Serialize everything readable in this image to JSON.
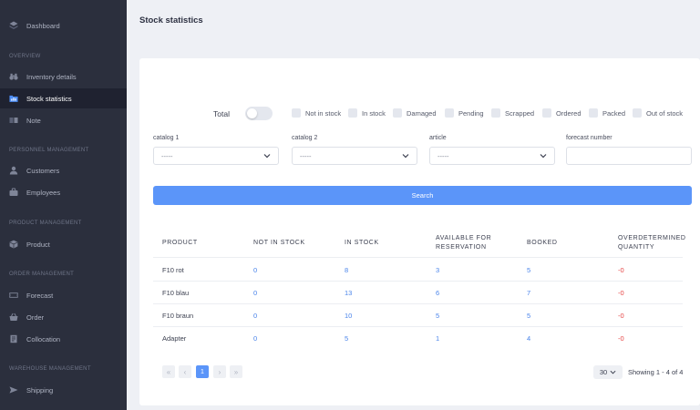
{
  "sidebar": {
    "dashboard": "Dashboard",
    "sections": {
      "overview": "OVERVIEW",
      "personnel": "PERSONNEL MANAGEMENT",
      "product": "PRODUCT MANAGEMENT",
      "order": "ORDER MANAGEMENT",
      "warehouse": "WAREHOUSE MANAGEMENT"
    },
    "items": {
      "inventory_details": "Inventory details",
      "stock_statistics": "Stock statistics",
      "note": "Note",
      "customers": "Customers",
      "employees": "Employees",
      "product": "Product",
      "forecast": "Forecast",
      "order": "Order",
      "collocation": "Collocation",
      "shipping": "Shipping"
    },
    "active_item": "stock_statistics"
  },
  "page": {
    "title": "Stock statistics"
  },
  "filters": {
    "total_label": "Total",
    "total_on": false,
    "checkboxes": [
      "Not in stock",
      "In stock",
      "Damaged",
      "Pending",
      "Scrapped",
      "Ordered",
      "Packed",
      "Out of stock"
    ],
    "catalog1": {
      "label": "catalog 1",
      "value": "-----"
    },
    "catalog2": {
      "label": "catalog 2",
      "value": "-----"
    },
    "article": {
      "label": "article",
      "value": "-----"
    },
    "forecast": {
      "label": "forecast number",
      "value": ""
    },
    "search_label": "Search"
  },
  "table": {
    "headers": {
      "product": "PRODUCT",
      "not_in_stock": "NOT IN STOCK",
      "in_stock": "IN STOCK",
      "available_1": "AVAILABLE FOR",
      "available_2": "RESERVATION",
      "booked": "BOOKED",
      "overdetermined_1": "OVERDETERMINED",
      "overdetermined_2": "QUANTITY"
    },
    "rows": [
      {
        "product": "F10 rot",
        "not_in_stock": "0",
        "in_stock": "8",
        "available": "3",
        "booked": "5",
        "overdetermined": "-0"
      },
      {
        "product": "F10 blau",
        "not_in_stock": "0",
        "in_stock": "13",
        "available": "6",
        "booked": "7",
        "overdetermined": "-0"
      },
      {
        "product": "F10 braun",
        "not_in_stock": "0",
        "in_stock": "10",
        "available": "5",
        "booked": "5",
        "overdetermined": "-0"
      },
      {
        "product": "Adapter",
        "not_in_stock": "0",
        "in_stock": "5",
        "available": "1",
        "booked": "4",
        "overdetermined": "-0"
      }
    ]
  },
  "pagination": {
    "first": "«",
    "prev": "‹",
    "current": "1",
    "next": "›",
    "last": "»",
    "per_page": "30",
    "showing": "Showing 1 - 4 of 4"
  },
  "colors": {
    "sidebar_bg": "#2b2f3d",
    "accent": "#5b95f9",
    "link_number": "#4a84ea",
    "negative": "#e64545"
  }
}
